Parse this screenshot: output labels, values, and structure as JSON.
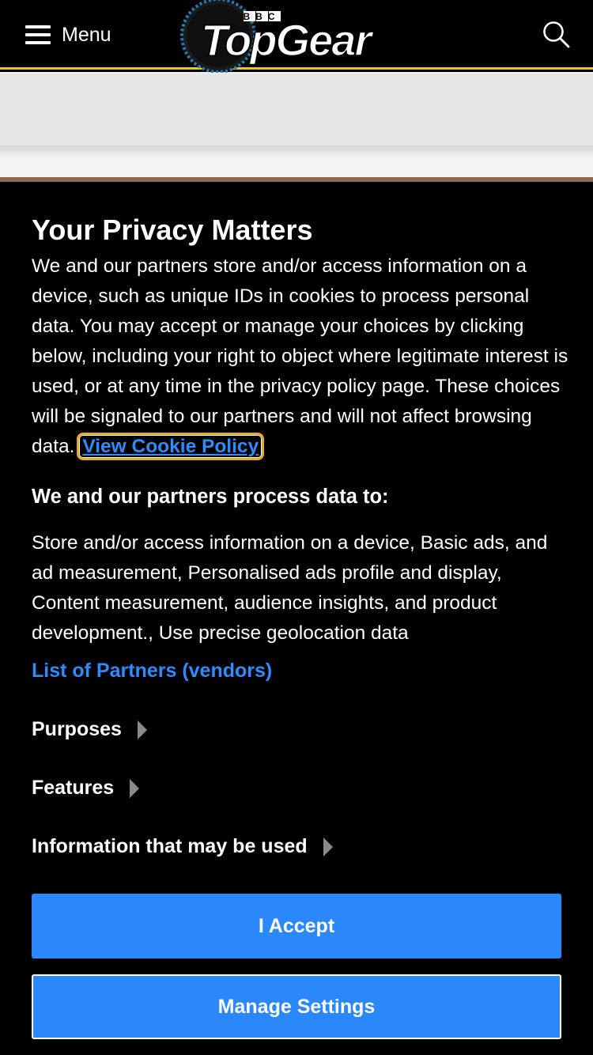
{
  "header": {
    "menu_label": "Menu",
    "logo_text": "TopGear",
    "logo_badge": "BBC",
    "icons": [
      "hamburger-icon",
      "search-icon"
    ]
  },
  "consent": {
    "title": "Your Privacy Matters",
    "description": "We and our partners store and/or access information on a device, such as unique IDs in cookies to process personal data. You may accept or manage your choices by clicking below, including your right to object where legitimate interest is used, or at any time in the privacy policy page. These choices will be signaled to our partners and will not affect browsing data.",
    "cookie_policy_link": "View Cookie Policy",
    "subheading": "We and our partners process data to:",
    "purposes_text": "Store and/or access information on a device, Basic ads, and ad measurement, Personalised ads profile and display, Content measurement, audience insights, and product development., Use precise geolocation data",
    "partners_link": "List of Partners (vendors)",
    "expanders": [
      "Purposes",
      "Features",
      "Information that may be used"
    ],
    "accept_button": "I Accept",
    "manage_button": "Manage Settings"
  },
  "colors": {
    "accent_blue": "#2a88fa",
    "link_blue": "#2f8bff",
    "header_border": "#e8c631",
    "focus_outline": "#e8a82a"
  }
}
